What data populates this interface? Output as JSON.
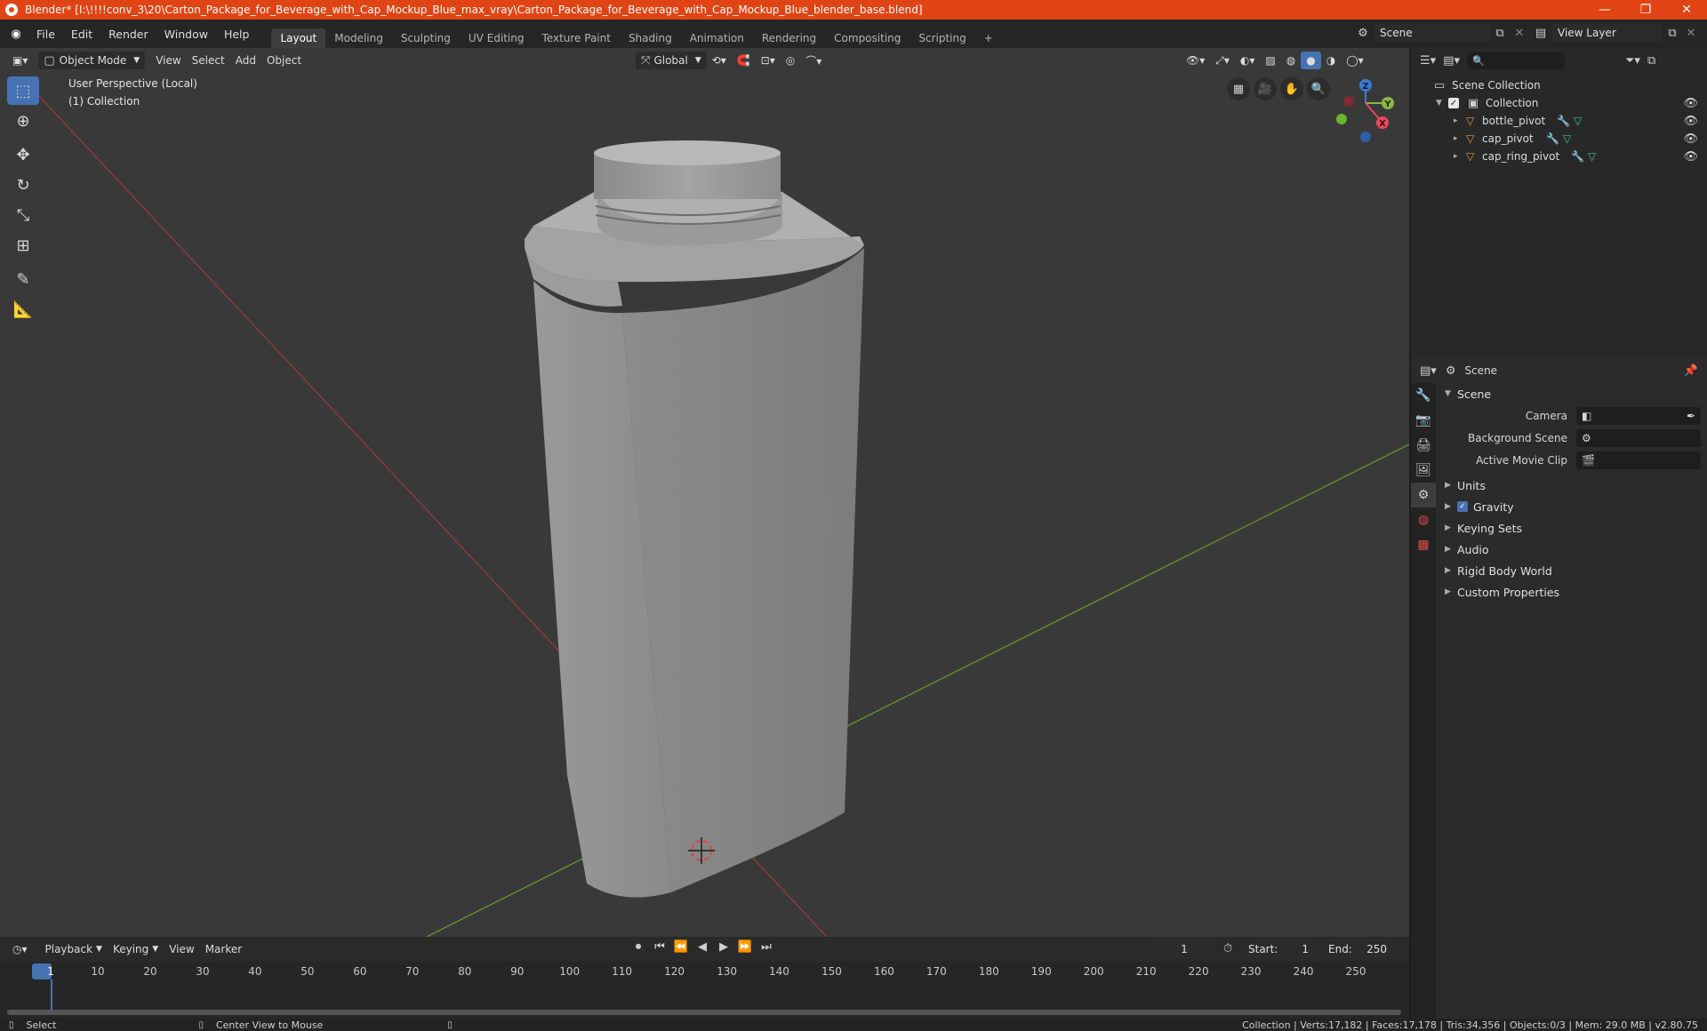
{
  "window": {
    "title": "Blender* [I:\\!!!!conv_3\\20\\Carton_Package_for_Beverage_with_Cap_Mockup_Blue_max_vray\\Carton_Package_for_Beverage_with_Cap_Mockup_Blue_blender_base.blend]",
    "controls": [
      "—",
      "❐",
      "✕"
    ]
  },
  "menu": {
    "items": [
      "File",
      "Edit",
      "Render",
      "Window",
      "Help"
    ],
    "workspaces": [
      "Layout",
      "Modeling",
      "Sculpting",
      "UV Editing",
      "Texture Paint",
      "Shading",
      "Animation",
      "Rendering",
      "Compositing",
      "Scripting"
    ],
    "active_workspace": "Layout",
    "add_workspace": "+",
    "scene_name": "Scene",
    "view_layer": "View Layer"
  },
  "viewport": {
    "mode": "Object Mode",
    "menus": [
      "View",
      "Select",
      "Add",
      "Object"
    ],
    "orientation": "Global",
    "overlay_title": "User Perspective (Local)",
    "overlay_collection": "(1) Collection",
    "gizmo_axes": [
      "Z",
      "Y",
      "X"
    ],
    "tools": [
      "select-box",
      "cursor",
      "move",
      "rotate",
      "scale",
      "transform",
      "annotate",
      "measure"
    ]
  },
  "outliner": {
    "root": "Scene Collection",
    "collection": "Collection",
    "objects": [
      "bottle_pivot",
      "cap_pivot",
      "cap_ring_pivot"
    ]
  },
  "properties": {
    "header_title": "Scene",
    "section": "Scene",
    "fields": [
      {
        "label": "Camera",
        "value": ""
      },
      {
        "label": "Background Scene",
        "value": ""
      },
      {
        "label": "Active Movie Clip",
        "value": ""
      }
    ],
    "panels": [
      "Units",
      "Gravity",
      "Keying Sets",
      "Audio",
      "Rigid Body World",
      "Custom Properties"
    ],
    "gravity_checked": true
  },
  "timeline": {
    "menus": [
      "Playback",
      "Keying",
      "View",
      "Marker"
    ],
    "current_frame": "1",
    "start_label": "Start:",
    "start_value": "1",
    "end_label": "End:",
    "end_value": "250",
    "ruler": [
      "1",
      "10",
      "20",
      "30",
      "40",
      "50",
      "60",
      "70",
      "80",
      "90",
      "100",
      "110",
      "120",
      "130",
      "140",
      "150",
      "160",
      "170",
      "180",
      "190",
      "200",
      "210",
      "220",
      "230",
      "240",
      "250"
    ]
  },
  "status": {
    "left_action": "Select",
    "middle_action": "Center View to Mouse",
    "stats": "Collection | Verts:17,182 | Faces:17,178 | Tris:34,356 | Objects:0/3 | Mem: 29.0 MB | v2.80.75"
  },
  "colors": {
    "title_bar": "#e14414",
    "accent": "#4772b3",
    "axis_x": "#c3383f",
    "axis_y": "#6b9c2a"
  }
}
